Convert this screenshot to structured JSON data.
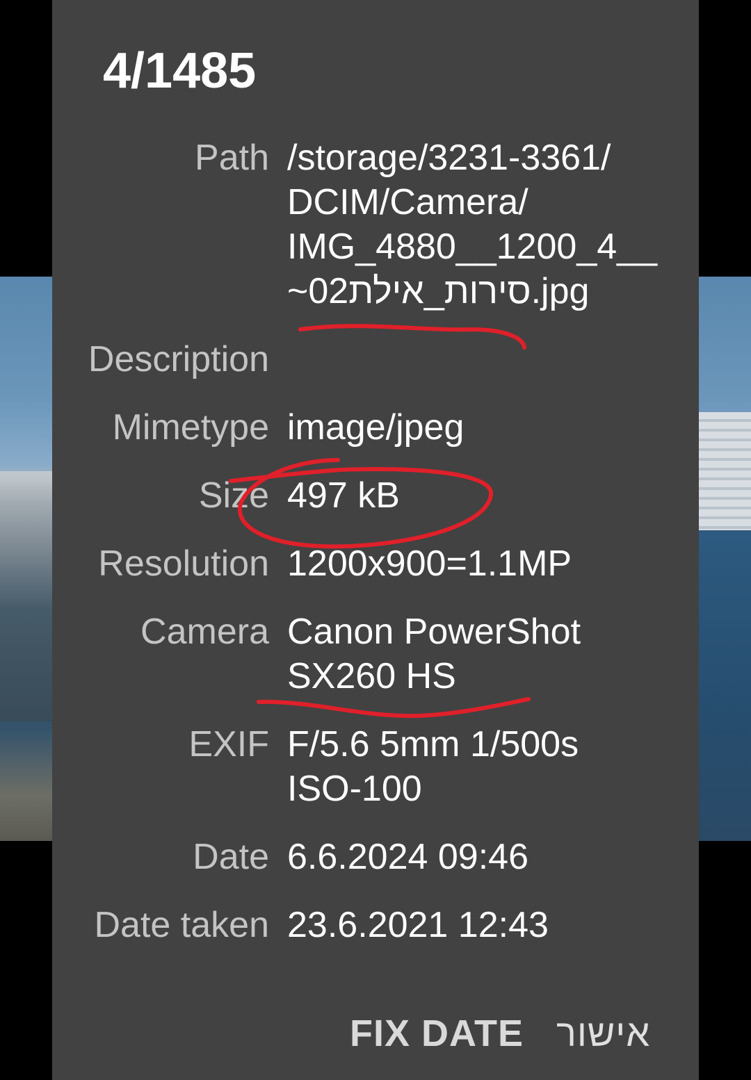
{
  "dialog": {
    "title": "4/1485",
    "rows": {
      "path": {
        "label": "Path",
        "value": "/storage/3231-3361/\nDCIM/Camera/\nIMG_4880__1200_4__\n~סירות_אילת02.jpg"
      },
      "description": {
        "label": "Description",
        "value": ""
      },
      "mimetype": {
        "label": "Mimetype",
        "value": "image/jpeg"
      },
      "size": {
        "label": "Size",
        "value": "497 kB"
      },
      "resolution": {
        "label": "Resolution",
        "value": "1200x900=1.1MP"
      },
      "camera": {
        "label": "Camera",
        "value": "Canon PowerShot\nSX260 HS"
      },
      "exif": {
        "label": "EXIF",
        "value": "F/5.6 5mm 1/500s\nISO-100"
      },
      "date": {
        "label": "Date",
        "value": "6.6.2024 09:46"
      },
      "date_taken": {
        "label": "Date taken",
        "value": "23.6.2021 12:43"
      }
    },
    "actions": {
      "fix_date": "FIX DATE",
      "ok": "אישור"
    }
  },
  "colors": {
    "dialog_bg": "#424242",
    "label": "#c4c4c4",
    "value": "#ffffff",
    "annotation": "#e0202a"
  }
}
